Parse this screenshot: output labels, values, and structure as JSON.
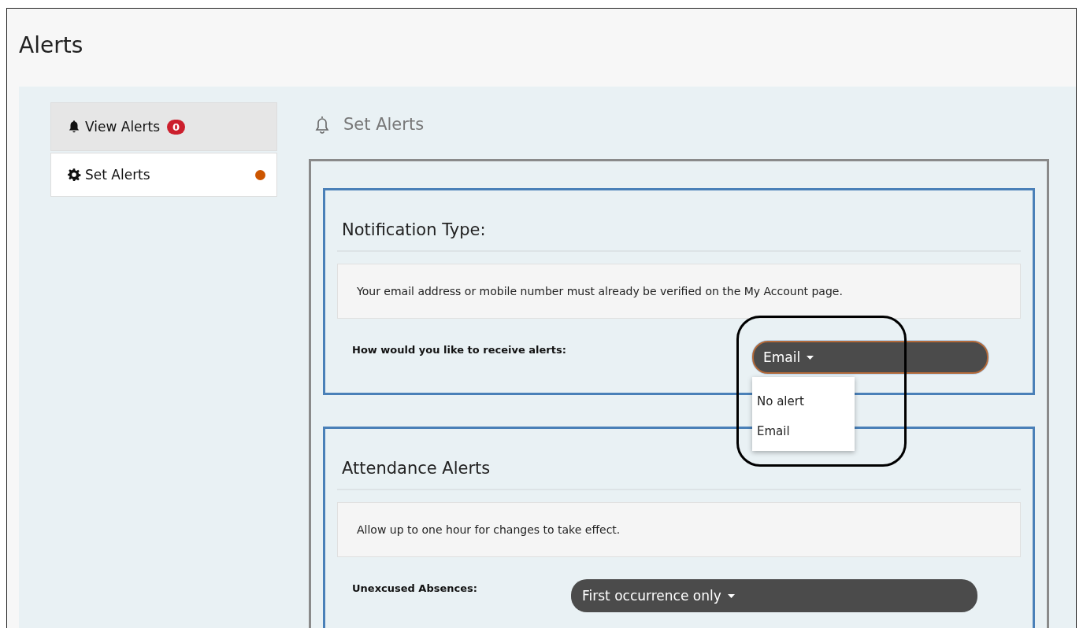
{
  "page": {
    "title": "Alerts"
  },
  "sidebar": {
    "items": [
      {
        "label": "View Alerts",
        "kind": "bell",
        "badge": "0",
        "selected": false
      },
      {
        "label": "Set Alerts",
        "kind": "gear",
        "selected": true
      }
    ]
  },
  "main": {
    "heading": "Set Alerts",
    "sections": [
      {
        "title": "Notification Type:",
        "note": "Your email address or mobile number must already be verified on the My Account page.",
        "fields": [
          {
            "label": "How would you like to receive alerts:",
            "value": "Email",
            "expanded": true,
            "highlighted": true,
            "options": [
              {
                "label": "No alert"
              },
              {
                "label": "Email"
              }
            ]
          }
        ]
      },
      {
        "title": "Attendance Alerts",
        "note": "Allow up to one hour for changes to take effect.",
        "fields": [
          {
            "label": "Unexcused Absences:",
            "value": "First occurrence only",
            "expanded": false,
            "highlighted": false
          }
        ]
      }
    ]
  }
}
